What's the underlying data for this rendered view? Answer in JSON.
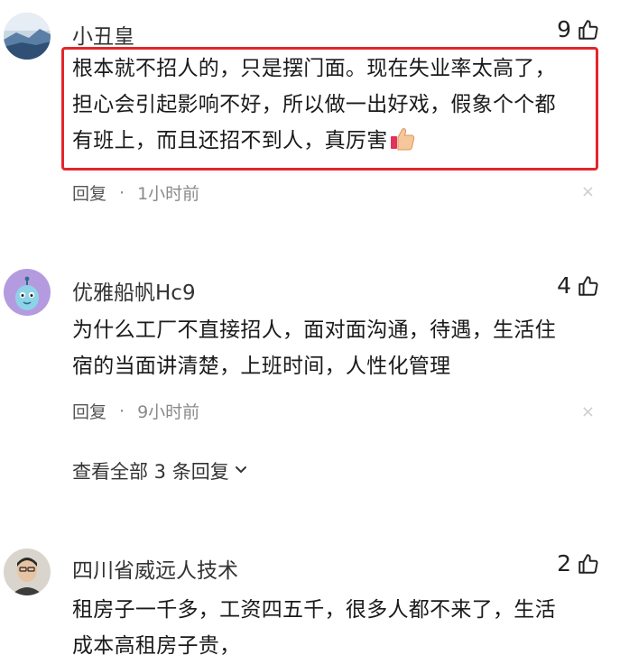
{
  "comments": [
    {
      "username": "小丑皇",
      "likes": "9",
      "lines": [
        "根本就不招人的，只是摆门面。现在失业率太高了，",
        "担心会引起影响不好，所以做一出好戏，假象个个都",
        "有班上，而且还招不到人，真厉害"
      ],
      "reply_label": "回复",
      "separator": "·",
      "time": "1小时前",
      "close": "×"
    },
    {
      "username": "优雅船帆Hc9",
      "likes": "4",
      "lines": [
        "为什么工厂不直接招人，面对面沟通，待遇，生活住",
        "宿的当面讲清楚，上班时间，人性化管理"
      ],
      "reply_label": "回复",
      "separator": "·",
      "time": "9小时前",
      "close": "×",
      "view_replies": "查看全部 3 条回复"
    },
    {
      "username": "四川省威远人技术",
      "likes": "2",
      "lines": [
        "租房子一千多，工资四五千，很多人都不来了，生活",
        "成本高租房子贵，"
      ]
    }
  ],
  "colors": {
    "highlight_border": "#e3262b",
    "meta_gray": "#8a8a8a"
  },
  "icons": {
    "like": "thumbs-up-icon",
    "chevron": "chevron-down-icon",
    "close": "close-icon",
    "emoji": "thumbs-up-emoji-icon"
  }
}
